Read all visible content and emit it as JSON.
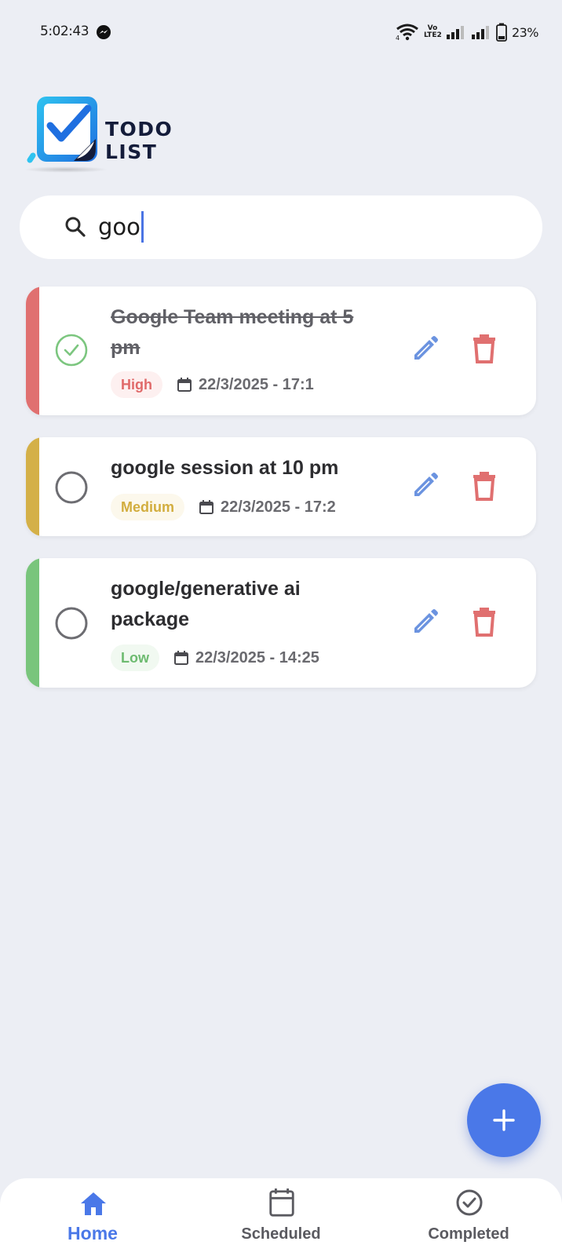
{
  "status_bar": {
    "time": "5:02:43",
    "network_label_top": "VoLTE",
    "network_label_top_a": "Vo",
    "network_label_bottom": "LTE2",
    "wifi_badge": "4",
    "battery": "23%"
  },
  "app": {
    "logo_text": "TODO LIST"
  },
  "search": {
    "value": "goo",
    "icon": "search-icon"
  },
  "tasks": [
    {
      "title_line1": "Google Team meeting at 5",
      "title_line2": "pm",
      "completed": true,
      "priority": "High",
      "date": "22/3/2025 - 17:1",
      "accent_color": "#e07070",
      "priority_color": "#e06a6a",
      "priority_bg": "#fdf0f0"
    },
    {
      "title_line1": "google session at 10 pm",
      "title_line2": "",
      "completed": false,
      "priority": "Medium",
      "date": "22/3/2025 - 17:2",
      "accent_color": "#d4b048",
      "priority_color": "#d2ad3e",
      "priority_bg": "#fcf8ec"
    },
    {
      "title_line1": "google/generative ai",
      "title_line2": "package",
      "completed": false,
      "priority": "Low",
      "date": "22/3/2025 - 14:25",
      "accent_color": "#79c57c",
      "priority_color": "#6dbb70",
      "priority_bg": "#f1f9f1"
    }
  ],
  "fab": {
    "icon": "plus-icon"
  },
  "bottom_nav": {
    "items": [
      {
        "label": "Home",
        "icon": "home-icon",
        "active": true
      },
      {
        "label": "Scheduled",
        "icon": "calendar-icon",
        "active": false
      },
      {
        "label": "Completed",
        "icon": "check-circle-icon",
        "active": false
      }
    ]
  },
  "colors": {
    "background": "#eceef4",
    "accent": "#4a78e8",
    "edit_icon": "#6b93e0",
    "delete_icon": "#e07070",
    "completed_check": "#7cc67f",
    "inactive_nav": "#5a5a60"
  }
}
